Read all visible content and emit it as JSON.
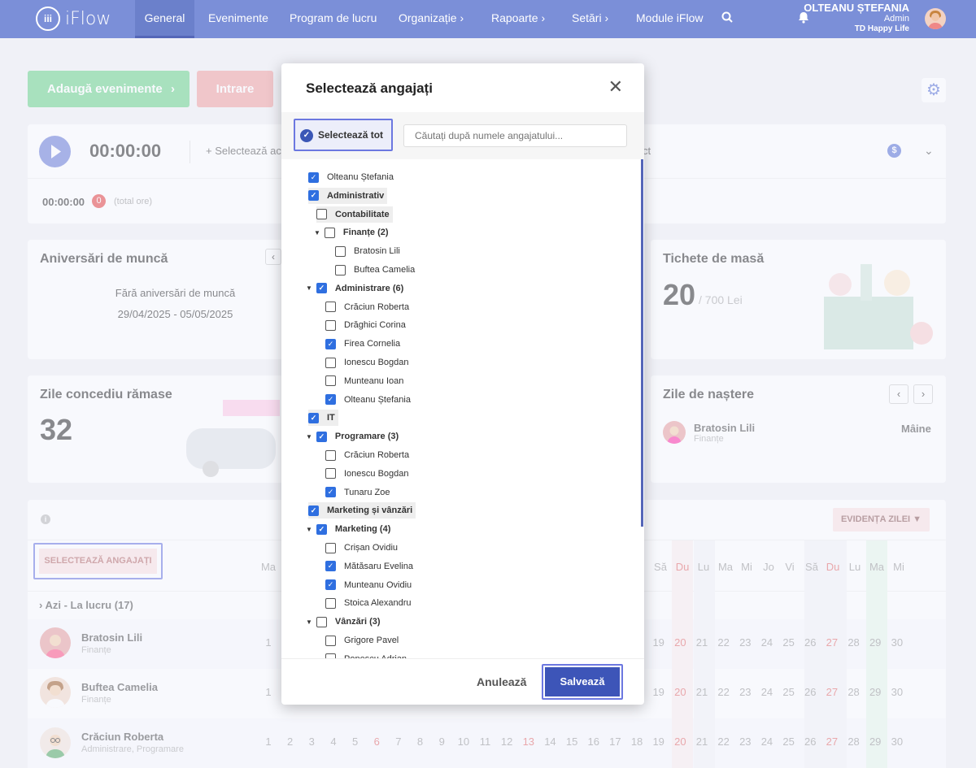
{
  "nav": {
    "logo_text": "iFlow",
    "items": [
      "General",
      "Evenimente",
      "Program de lucru",
      "Organizație",
      "Rapoarte",
      "Setări",
      "Module iFlow"
    ],
    "user_name": "OLTEANU ȘTEFANIA",
    "user_role": "Admin",
    "user_company": "TD Happy Life"
  },
  "actions": {
    "add_events": "Adaugă evenimente",
    "enter": "Intrare"
  },
  "timer": {
    "time": "00:00:00",
    "select": "Selectează ac",
    "select_suffix": "ct",
    "total_time": "00:00:00",
    "total_badge": "0",
    "total_label": "(total ore)"
  },
  "anniversaries": {
    "title": "Aniversări de muncă",
    "empty": "Fără aniversări de muncă",
    "range": "29/04/2025 - 05/05/2025"
  },
  "meal_tickets": {
    "title": "Tichete de masă",
    "count": "20",
    "amount": "/ 700 Lei"
  },
  "vacation": {
    "title": "Zile concediu rămase",
    "days": "32"
  },
  "birthdays": {
    "title": "Zile de naștere",
    "name": "Bratosin Lili",
    "dept": "Finanțe",
    "when": "Mâine"
  },
  "schedule": {
    "select_employees": "SELECTEAZĂ ANGAJAȚI",
    "day_filter": "EVIDENȚA ZILEI",
    "group": "Azi - La lucru (17)",
    "day_headers": [
      "Ma",
      "Să",
      "Du",
      "Lu",
      "Ma",
      "Mi",
      "Jo",
      "Vi",
      "Să",
      "Du",
      "Lu",
      "Ma",
      "Mi"
    ],
    "tail_days": [
      "19",
      "20",
      "21",
      "22",
      "23",
      "24",
      "25",
      "26",
      "27",
      "28",
      "29",
      "30"
    ],
    "full_days": [
      "1",
      "2",
      "3",
      "4",
      "5",
      "6",
      "7",
      "8",
      "9",
      "10",
      "11",
      "12",
      "13",
      "14",
      "15",
      "16",
      "17",
      "18",
      "19",
      "20",
      "21",
      "22",
      "23",
      "24",
      "25",
      "26",
      "27",
      "28",
      "29",
      "30"
    ],
    "employees": [
      {
        "name": "Bratosin Lili",
        "dept": "Finanțe"
      },
      {
        "name": "Buftea Camelia",
        "dept": "Finanțe"
      },
      {
        "name": "Crăciun Roberta",
        "dept": "Administrare, Programare"
      }
    ]
  },
  "modal": {
    "title": "Selectează angajați",
    "select_all": "Selectează tot",
    "search_placeholder": "Căutați după numele angajatului...",
    "cancel": "Anulează",
    "save": "Salvează",
    "rows": [
      {
        "label": "Olteanu Ștefania",
        "checked": true,
        "level": 0,
        "bold": false,
        "hl": false,
        "caret": false
      },
      {
        "label": "Administrativ",
        "checked": true,
        "level": 0,
        "bold": true,
        "hl": true,
        "caret": false
      },
      {
        "label": "Contabilitate",
        "checked": false,
        "level": 1,
        "bold": true,
        "hl": true,
        "caret": false
      },
      {
        "label": "Finanțe  (2)",
        "checked": false,
        "level": 2,
        "bold": true,
        "hl": false,
        "caret": true
      },
      {
        "label": "Bratosin Lili",
        "checked": false,
        "level": 3,
        "bold": false,
        "hl": false,
        "caret": false
      },
      {
        "label": "Buftea Camelia",
        "checked": false,
        "level": 3,
        "bold": false,
        "hl": false,
        "caret": false
      },
      {
        "label": "Administrare  (6)",
        "checked": true,
        "level": 1,
        "bold": true,
        "hl": false,
        "caret": true
      },
      {
        "label": "Crăciun Roberta",
        "checked": false,
        "level": 2,
        "bold": false,
        "hl": false,
        "caret": false
      },
      {
        "label": "Drăghici Corina",
        "checked": false,
        "level": 2,
        "bold": false,
        "hl": false,
        "caret": false
      },
      {
        "label": "Firea Cornelia",
        "checked": true,
        "level": 2,
        "bold": false,
        "hl": false,
        "caret": false
      },
      {
        "label": "Ionescu Bogdan",
        "checked": false,
        "level": 2,
        "bold": false,
        "hl": false,
        "caret": false
      },
      {
        "label": "Munteanu Ioan",
        "checked": false,
        "level": 2,
        "bold": false,
        "hl": false,
        "caret": false
      },
      {
        "label": "Olteanu Ștefania",
        "checked": true,
        "level": 2,
        "bold": false,
        "hl": false,
        "caret": false
      },
      {
        "label": "IT",
        "checked": true,
        "level": 0,
        "bold": true,
        "hl": true,
        "caret": false
      },
      {
        "label": "Programare  (3)",
        "checked": true,
        "level": 1,
        "bold": true,
        "hl": false,
        "caret": true
      },
      {
        "label": "Crăciun Roberta",
        "checked": false,
        "level": 2,
        "bold": false,
        "hl": false,
        "caret": false
      },
      {
        "label": "Ionescu Bogdan",
        "checked": false,
        "level": 2,
        "bold": false,
        "hl": false,
        "caret": false
      },
      {
        "label": "Tunaru Zoe",
        "checked": true,
        "level": 2,
        "bold": false,
        "hl": false,
        "caret": false
      },
      {
        "label": "Marketing și vânzări",
        "checked": true,
        "level": 0,
        "bold": true,
        "hl": true,
        "caret": false
      },
      {
        "label": "Marketing  (4)",
        "checked": true,
        "level": 1,
        "bold": true,
        "hl": false,
        "caret": true
      },
      {
        "label": "Crișan Ovidiu",
        "checked": false,
        "level": 2,
        "bold": false,
        "hl": false,
        "caret": false
      },
      {
        "label": "Mătăsaru Evelina",
        "checked": true,
        "level": 2,
        "bold": false,
        "hl": false,
        "caret": false
      },
      {
        "label": "Munteanu Ovidiu",
        "checked": true,
        "level": 2,
        "bold": false,
        "hl": false,
        "caret": false
      },
      {
        "label": "Stoica Alexandru",
        "checked": false,
        "level": 2,
        "bold": false,
        "hl": false,
        "caret": false
      },
      {
        "label": "Vânzări  (3)",
        "checked": false,
        "level": 1,
        "bold": true,
        "hl": false,
        "caret": true
      },
      {
        "label": "Grigore Pavel",
        "checked": false,
        "level": 2,
        "bold": false,
        "hl": false,
        "caret": false
      },
      {
        "label": "Popescu Adrian",
        "checked": false,
        "level": 2,
        "bold": false,
        "hl": false,
        "caret": false
      }
    ]
  },
  "colors": {
    "nav": "#7b8fd8",
    "accent": "#3d55b8",
    "highlight_border": "#6c78e0",
    "green": "#6ed38c",
    "red_button": "#f0a2a2"
  }
}
